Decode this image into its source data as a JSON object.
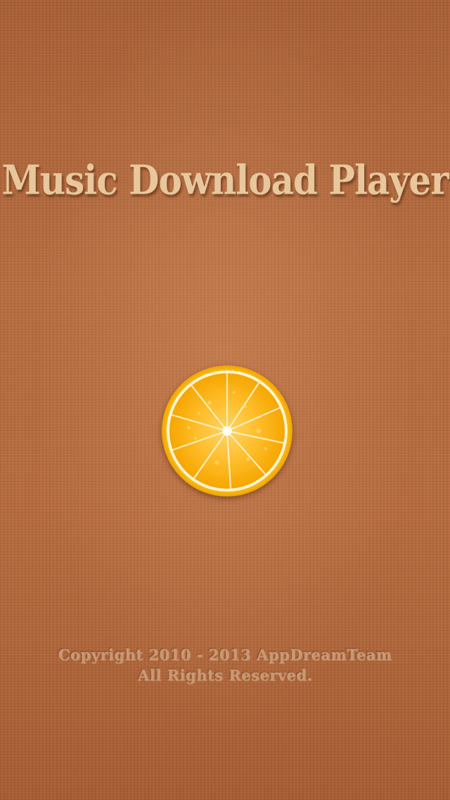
{
  "splash": {
    "title": "Music Download Player",
    "logo_icon": "orange-slice-icon",
    "copyright_line": "Copyright 2010 - 2013 AppDreamTeam",
    "rights_line": "All Rights Reserved."
  },
  "colors": {
    "background": "#b2683c",
    "title_text": "#e8c79c",
    "footer_text": "#c79a74",
    "orange_peel": "#fbb300",
    "orange_pulp": "#ffb41c",
    "orange_pith": "#fff6d8"
  }
}
